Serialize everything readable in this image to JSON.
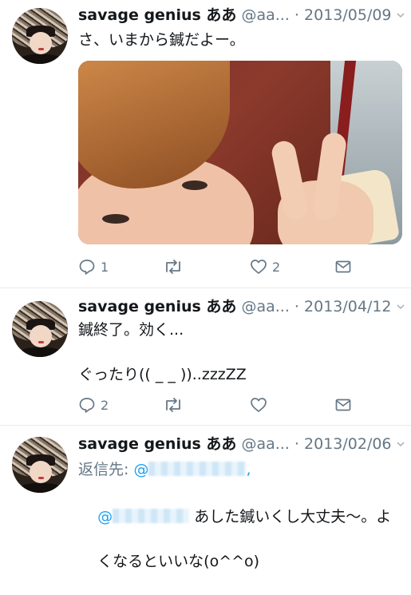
{
  "tweets": [
    {
      "name": "savage genius ああ",
      "handle": "@aa...",
      "separator": "·",
      "date": "2013/05/09",
      "text": "さ、いまから鍼だよー。",
      "has_media": true,
      "actions": {
        "replies": "1",
        "retweets": "",
        "likes": "2"
      }
    },
    {
      "name": "savage genius ああ",
      "handle": "@aa...",
      "separator": "·",
      "date": "2013/04/12",
      "text": "鍼終了。効く...\n\nぐったり(( _ _ ))..zzzZZ",
      "actions": {
        "replies": "2",
        "retweets": "",
        "likes": ""
      }
    },
    {
      "name": "savage genius ああ",
      "handle": "@aa...",
      "separator": "·",
      "date": "2013/02/06",
      "reply_to_label": "返信先: ",
      "reply_to_mention": "@",
      "reply_to_trailing": ",",
      "mention_prefix": "@",
      "text_line1": "あした鍼いくし大丈夫〜。よ",
      "text_line2": "くなるといいな(o^^o)"
    }
  ],
  "colors": {
    "text": "#14171a",
    "secondary": "#657786",
    "link": "#1da1f2",
    "divider": "#e6ecf0"
  }
}
